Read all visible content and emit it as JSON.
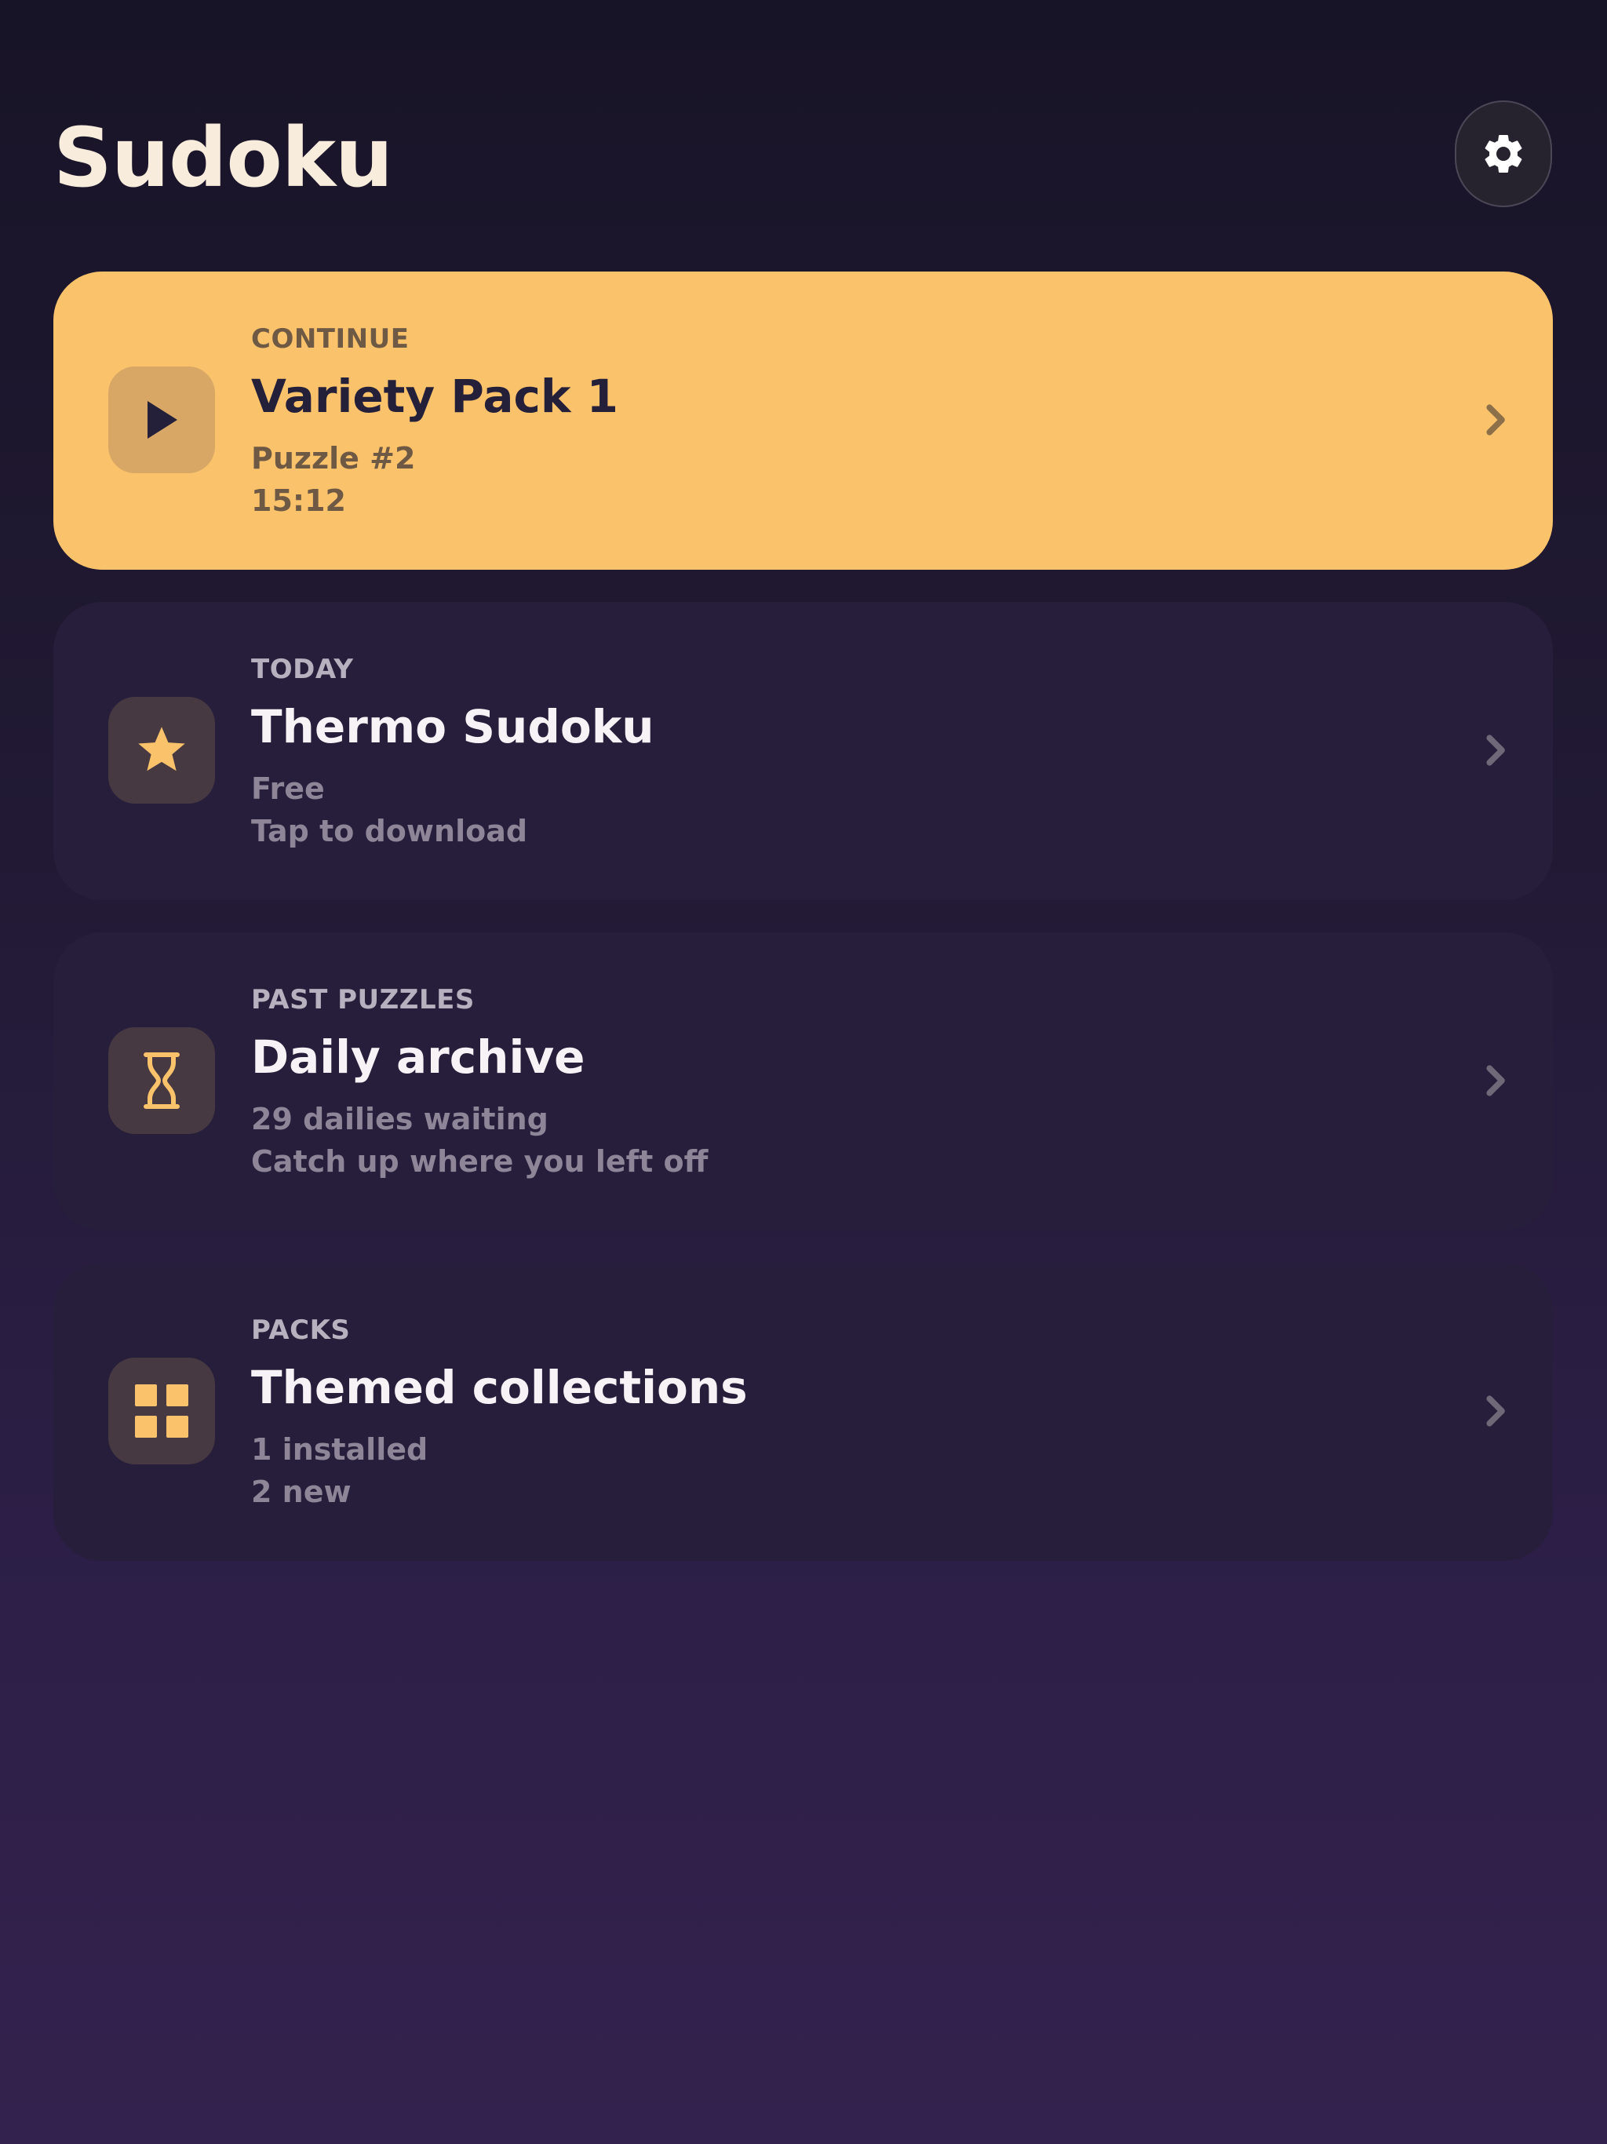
{
  "header": {
    "title": "Sudoku"
  },
  "cards": [
    {
      "eyebrow": "CONTINUE",
      "title": "Variety Pack 1",
      "line1": "Puzzle #2",
      "line2": "15:12",
      "icon": "play-icon"
    },
    {
      "eyebrow": "TODAY",
      "title": "Thermo Sudoku",
      "line1": "Free",
      "line2": "Tap to download",
      "icon": "star-icon"
    },
    {
      "eyebrow": "PAST PUZZLES",
      "title": "Daily archive",
      "line1": "29 dailies waiting",
      "line2": "Catch up where you left off",
      "icon": "hourglass-icon"
    },
    {
      "eyebrow": "PACKS",
      "title": "Themed collections",
      "line1": "1 installed",
      "line2": "2 new",
      "icon": "grid-icon"
    }
  ],
  "colors": {
    "accent": "#fac26b",
    "card_background": "#261e3a",
    "icon_tile": "#473941",
    "text_primary": "#f7f2f6",
    "text_secondary": "#8e8599"
  }
}
